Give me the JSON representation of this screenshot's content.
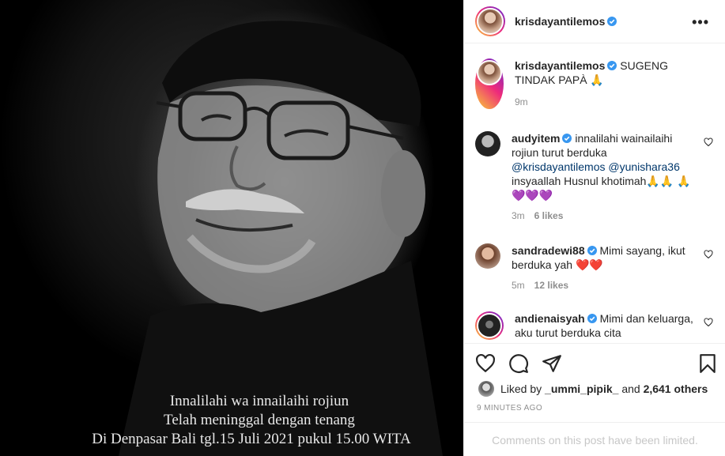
{
  "photo": {
    "caption_lines": [
      "Innalilahi wa innailaihi rojiun",
      "Telah meninggal dengan tenang",
      "Di Denpasar Bali  tgl.15 Juli 2021 pukul 15.00 WITA"
    ]
  },
  "post": {
    "author": "krisdayantilemos",
    "more_icon": "more-horizontal-icon",
    "caption_user": "krisdayantilemos",
    "caption_text": "SUGENG TINDAK PAPÀ 🙏",
    "caption_time": "9m"
  },
  "comments": [
    {
      "user": "audyitem",
      "text_before": "innalilahi wainailaihi rojiun turut berduka",
      "mentions": [
        "@krisdayantilemos",
        "@yunishara36"
      ],
      "text_after": "insyaallah Husnul khotimah🙏🙏 🙏💜💜💜",
      "time": "3m",
      "likes": "6 likes"
    },
    {
      "user": "sandradewi88",
      "text": "Mimi sayang, ikut berduka yah ❤️❤️",
      "time": "5m",
      "likes": "12 likes"
    },
    {
      "user": "andienaisyah",
      "text": "Mimi dan keluarga, aku turut berduka cita"
    }
  ],
  "actions": {
    "liked_by_prefix": "Liked by",
    "liked_by_user": "_ummi_pipik_",
    "liked_by_and": "and",
    "liked_by_count": "2,641 others",
    "time_ago": "9 MINUTES AGO",
    "comments_limited": "Comments on this post have been limited."
  },
  "colors": {
    "verified": "#3897f0",
    "border": "#efefef",
    "secondary_text": "#8e8e8e",
    "mention": "#00376b"
  }
}
